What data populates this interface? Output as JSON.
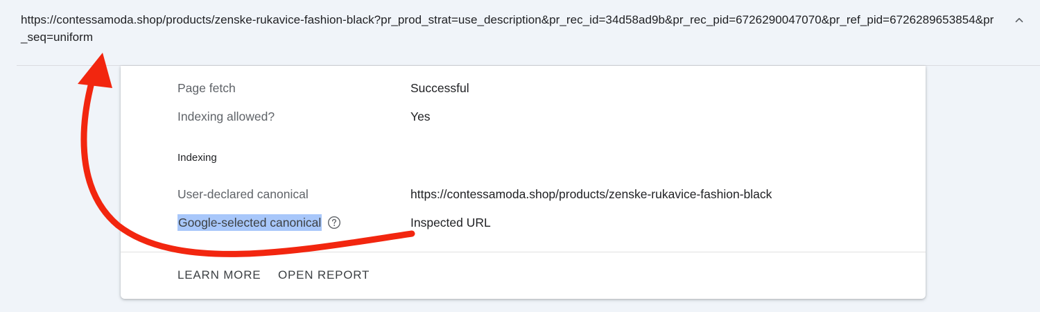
{
  "header": {
    "url": "https://contessamoda.shop/products/zenske-rukavice-fashion-black?pr_prod_strat=use_description&pr_rec_id=34d58ad9b&pr_rec_pid=6726290047070&pr_ref_pid=6726289653854&pr_seq=uniform",
    "collapse_icon": "chevron-up-icon"
  },
  "crawl": {
    "page_fetch_label": "Page fetch",
    "page_fetch_value": "Successful",
    "indexing_allowed_label": "Indexing allowed?",
    "indexing_allowed_value": "Yes"
  },
  "indexing": {
    "section_title": "Indexing",
    "user_canonical_label": "User-declared canonical",
    "user_canonical_value": "https://contessamoda.shop/products/zenske-rukavice-fashion-black",
    "google_canonical_label": "Google-selected canonical",
    "google_canonical_value": "Inspected URL",
    "help_icon": "help-circle-icon"
  },
  "actions": {
    "learn_more": "LEARN MORE",
    "open_report": "OPEN REPORT"
  },
  "colors": {
    "background": "#f0f4f9",
    "card": "#ffffff",
    "highlight": "#a8c7fa",
    "annotation_arrow": "#f2260f"
  }
}
